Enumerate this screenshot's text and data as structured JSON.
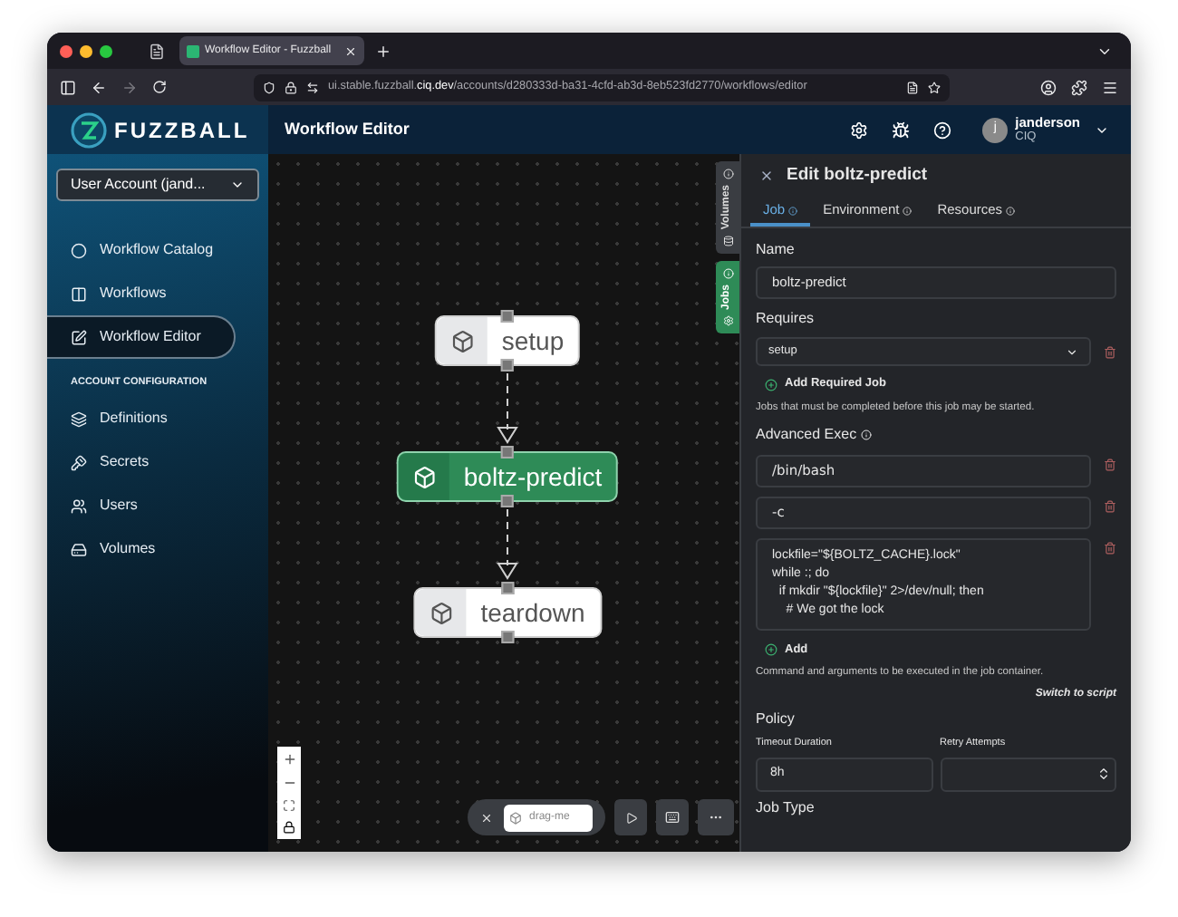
{
  "browser": {
    "tab_title": "Workflow Editor - Fuzzball",
    "url": "ui.stable.fuzzball.**ciq.dev**/accounts/d280333d-ba31-4cfd-ab3d-8eb523fd2770/workflows/editor"
  },
  "header": {
    "logo": "FUZZBALL",
    "title": "Workflow Editor",
    "user": {
      "initial": "j",
      "name": "janderson",
      "org": "CIQ"
    }
  },
  "sidebar": {
    "account_selector": "User Account (jand...",
    "items": [
      {
        "label": "Workflow Catalog",
        "kind": "catalog",
        "selected": false
      },
      {
        "label": "Workflows",
        "kind": "workflows",
        "selected": false
      },
      {
        "label": "Workflow Editor",
        "kind": "editor",
        "selected": true
      }
    ],
    "section_heading": "ACCOUNT CONFIGURATION",
    "config_items": [
      {
        "label": "Definitions",
        "kind": "definitions",
        "selected": false
      },
      {
        "label": "Secrets",
        "kind": "secrets",
        "selected": false
      },
      {
        "label": "Users",
        "kind": "users",
        "selected": false
      },
      {
        "label": "Volumes",
        "kind": "volumes",
        "selected": false
      }
    ]
  },
  "canvas": {
    "nodes": [
      {
        "label": "setup",
        "selected": false
      },
      {
        "label": "boltz-predict",
        "selected": true
      },
      {
        "label": "teardown",
        "selected": false
      }
    ],
    "side_tabs": [
      {
        "label": "Volumes",
        "selected": false
      },
      {
        "label": "Jobs",
        "selected": true
      }
    ],
    "toolbar": {
      "drag_label": "drag-me"
    }
  },
  "panel": {
    "title": "Edit boltz-predict",
    "tabs": [
      {
        "label": "Job",
        "selected": true
      },
      {
        "label": "Environment",
        "selected": false
      },
      {
        "label": "Resources",
        "selected": false
      }
    ],
    "name_label": "Name",
    "name_value": "boltz-predict",
    "requires_label": "Requires",
    "requires": [
      "setup"
    ],
    "add_required": "Add Required Job",
    "requires_help": "Jobs that must be completed before this job may be started.",
    "exec_label": "Advanced Exec",
    "exec_args": [
      "/bin/bash",
      "-c"
    ],
    "exec_script": "lockfile=\"${BOLTZ_CACHE}.lock\"\nwhile :; do\n  if mkdir \"${lockfile}\" 2>/dev/null; then\n    # We got the lock",
    "add_arg": "Add",
    "exec_help": "Command and arguments to be executed in the job container.",
    "switch_link": "Switch to script",
    "policy_label": "Policy",
    "timeout_label": "Timeout Duration",
    "timeout_value": "8h",
    "retry_label": "Retry Attempts",
    "job_type_label": "Job Type"
  }
}
